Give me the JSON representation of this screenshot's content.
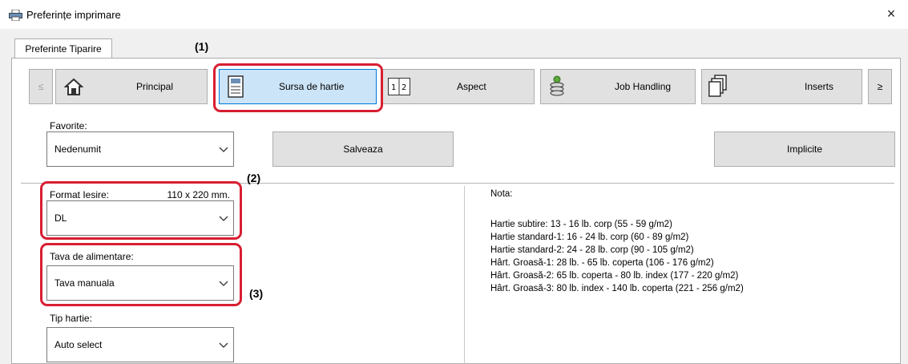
{
  "window": {
    "title": "Preferințe imprimare",
    "close_glyph": "×"
  },
  "tab": {
    "label": "Preferinte Tiparire"
  },
  "nav": {
    "prev": "≤",
    "next": "≥",
    "items": [
      {
        "label": "Principal",
        "icon": "home-icon"
      },
      {
        "label": "Sursa de hartie",
        "icon": "paper-tray-icon",
        "selected": true
      },
      {
        "label": "Aspect",
        "icon": "layout-icon",
        "icon_text": "1|2"
      },
      {
        "label": "Job Handling",
        "icon": "job-stack-icon"
      },
      {
        "label": "Inserts",
        "icon": "inserts-icon"
      }
    ]
  },
  "favorites": {
    "label": "Favorite:",
    "value": "Nedenumit",
    "save_button": "Salveaza",
    "defaults_button": "Implicite"
  },
  "output_format": {
    "label": "Format Iesire:",
    "size": "110 x 220 mm.",
    "value": "DL"
  },
  "feed_tray": {
    "label": "Tava de alimentare:",
    "value": "Tava manuala"
  },
  "paper_type": {
    "label": "Tip hartie:",
    "value": "Auto select"
  },
  "note": {
    "heading": "Nota:",
    "lines": [
      "Hartie subtire: 13 - 16 lb. corp (55 - 59 g/m2)",
      "Hartie standard-1: 16 - 24 lb. corp (60 - 89 g/m2)",
      "Hartie standard-2: 24 - 28 lb. corp (90 - 105 g/m2)",
      "Hârt. Groasă-1: 28 lb. - 65 lb. coperta (106 - 176 g/m2)",
      "Hârt. Groasă-2: 65 lb. coperta - 80 lb. index (177 - 220 g/m2)",
      "Hârt. Groasă-3: 80 lb. index - 140 lb. coperta (221 - 256 g/m2)"
    ]
  },
  "callouts": {
    "c1": "(1)",
    "c2": "(2)",
    "c3": "(3)"
  },
  "colors": {
    "highlight": "#d81e32",
    "selected_bg": "#cce4f7",
    "selected_border": "#0078d7"
  }
}
